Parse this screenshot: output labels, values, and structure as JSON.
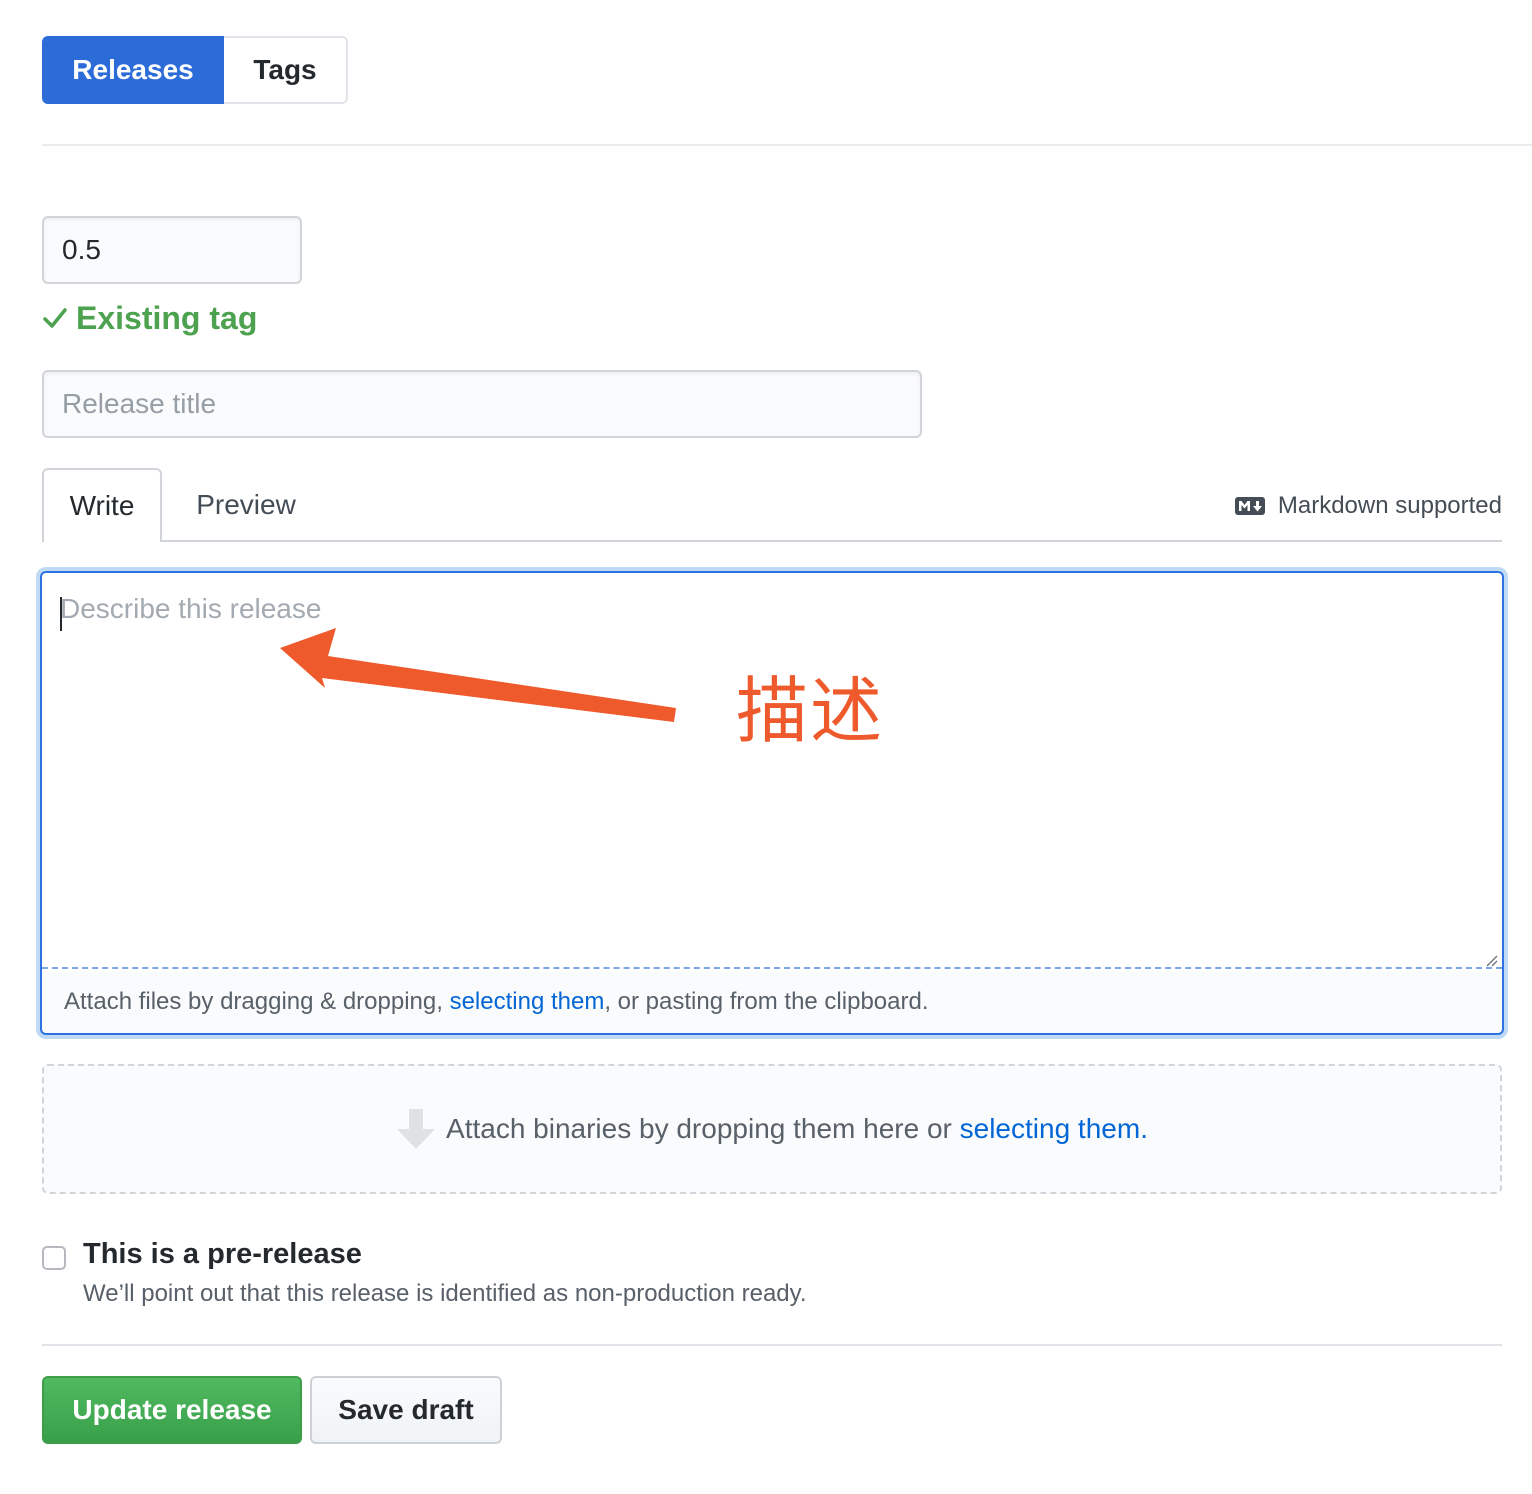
{
  "subnav": {
    "items": [
      {
        "label": "Releases",
        "active": true
      },
      {
        "label": "Tags",
        "active": false
      }
    ]
  },
  "tag": {
    "value": "0.5",
    "status": "Existing tag"
  },
  "release_title": {
    "placeholder": "Release title",
    "value": ""
  },
  "editor": {
    "tabs": [
      {
        "label": "Write",
        "active": true
      },
      {
        "label": "Preview",
        "active": false
      }
    ],
    "markdown_note": "Markdown supported",
    "placeholder": "Describe this release",
    "attach": {
      "prefix": "Attach files by dragging & dropping, ",
      "link": "selecting them",
      "suffix": ", or pasting from the clipboard."
    }
  },
  "annotation": {
    "text": "描述",
    "color": "#ee5a2b"
  },
  "binaries": {
    "prefix": "Attach binaries by dropping them here or ",
    "link": "selecting them",
    "suffix": "."
  },
  "prerelease": {
    "checked": false,
    "label": "This is a pre-release",
    "note": "We’ll point out that this release is identified as non-production ready."
  },
  "actions": {
    "primary": "Update release",
    "secondary": "Save draft"
  },
  "colors": {
    "accent_blue": "#2b6cd8",
    "success_green": "#4ca24e",
    "link": "#0366d6"
  },
  "icons": {
    "existing_tag": "check-icon",
    "markdown": "markdown-icon",
    "binaries": "arrow-down-icon",
    "annotation": "arrow-annotation-icon"
  }
}
